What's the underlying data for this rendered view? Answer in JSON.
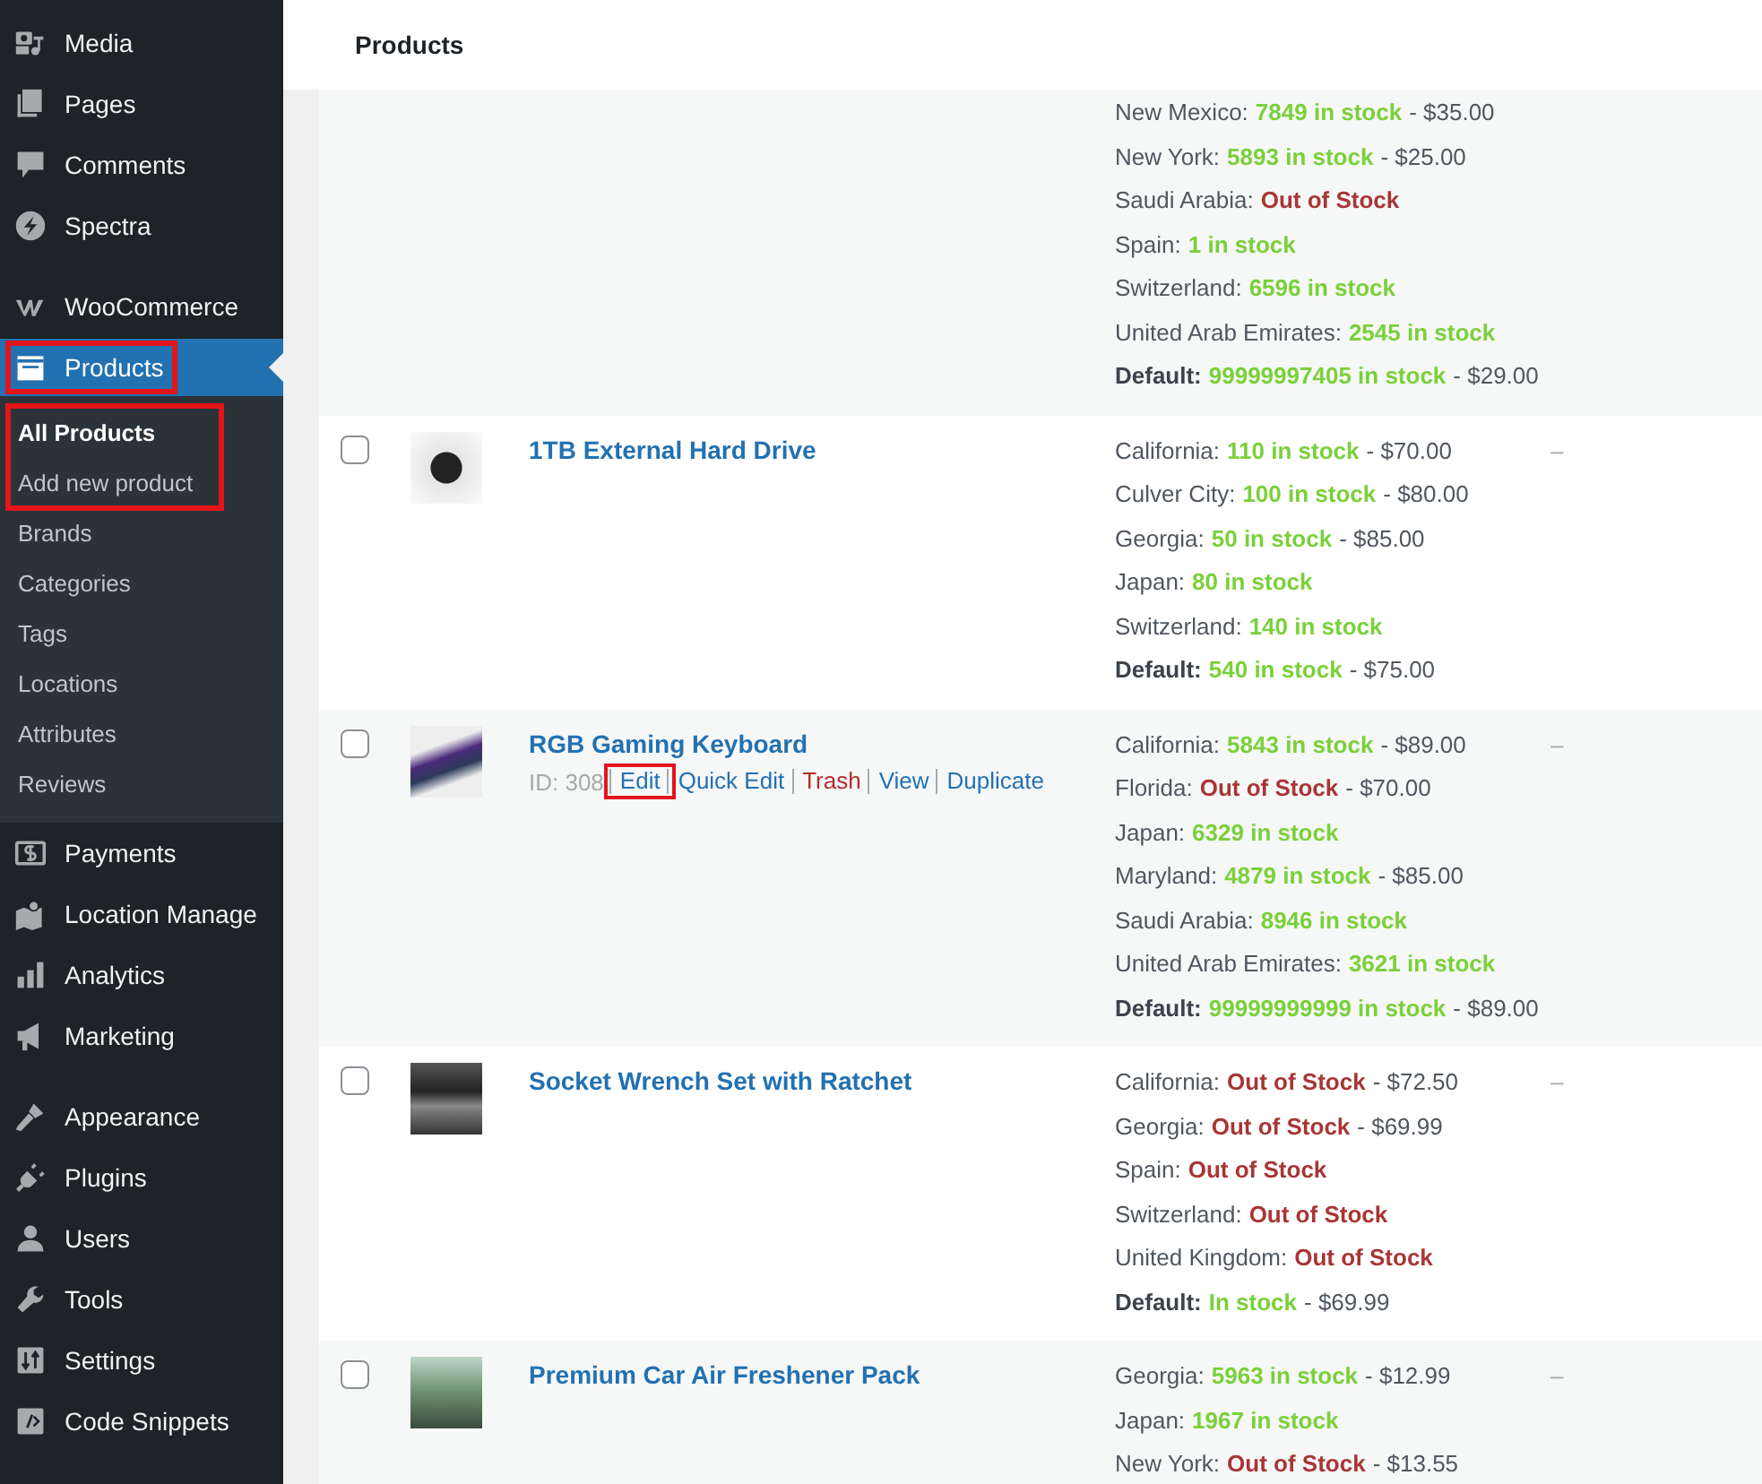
{
  "sidebar": {
    "groups": [
      {
        "items": [
          {
            "label": "Media",
            "current": false,
            "highlighted": false
          },
          {
            "label": "Pages",
            "current": false,
            "highlighted": false
          },
          {
            "label": "Comments",
            "current": false,
            "highlighted": false
          },
          {
            "label": "Spectra",
            "current": false,
            "highlighted": false
          }
        ]
      },
      {
        "items": [
          {
            "label": "WooCommerce",
            "current": false,
            "highlighted": false
          },
          {
            "label": "Products",
            "current": true,
            "highlighted": true,
            "submenu": [
              {
                "label": "All Products",
                "selected": true,
                "highlighted": true
              },
              {
                "label": "Add new product",
                "selected": false,
                "highlighted": true
              },
              {
                "label": "Brands",
                "selected": false,
                "highlighted": false
              },
              {
                "label": "Categories",
                "selected": false,
                "highlighted": false
              },
              {
                "label": "Tags",
                "selected": false,
                "highlighted": false
              },
              {
                "label": "Locations",
                "selected": false,
                "highlighted": false
              },
              {
                "label": "Attributes",
                "selected": false,
                "highlighted": false
              },
              {
                "label": "Reviews",
                "selected": false,
                "highlighted": false
              }
            ]
          },
          {
            "label": "Payments",
            "current": false,
            "highlighted": false
          },
          {
            "label": "Location Manage",
            "current": false,
            "highlighted": false
          },
          {
            "label": "Analytics",
            "current": false,
            "highlighted": false
          },
          {
            "label": "Marketing",
            "current": false,
            "highlighted": false
          }
        ]
      },
      {
        "items": [
          {
            "label": "Appearance",
            "current": false,
            "highlighted": false
          },
          {
            "label": "Plugins",
            "current": false,
            "highlighted": false
          },
          {
            "label": "Users",
            "current": false,
            "highlighted": false
          },
          {
            "label": "Tools",
            "current": false,
            "highlighted": false
          },
          {
            "label": "Settings",
            "current": false,
            "highlighted": false
          },
          {
            "label": "Code Snippets",
            "current": false,
            "highlighted": false
          }
        ]
      }
    ]
  },
  "header": {
    "title": "Products"
  },
  "table": {
    "rows": [
      {
        "stock": [
          {
            "location": "New Mexico:",
            "stock": "7849 in stock",
            "color": "#7ad03a",
            "price": "- $35.00",
            "default": false
          },
          {
            "location": "New York:",
            "stock": "5893 in stock",
            "color": "#7ad03a",
            "price": "- $25.00",
            "default": false
          },
          {
            "location": "Saudi Arabia:",
            "stock": "Out of Stock",
            "color": "#a83535",
            "default": false
          },
          {
            "location": "Spain:",
            "stock": "1 in stock",
            "color": "#7ad03a",
            "default": false
          },
          {
            "location": "Switzerland:",
            "stock": "6596 in stock",
            "color": "#7ad03a",
            "default": false
          },
          {
            "location": "United Arab Emirates:",
            "stock": "2545 in stock",
            "color": "#7ad03a",
            "default": false
          },
          {
            "location": "Default:",
            "stock": "99999997405 in stock",
            "color": "#7ad03a",
            "price": "- $29.00",
            "default": true
          }
        ]
      },
      {
        "checked": false,
        "name": "1TB External Hard Drive",
        "column_4": "–",
        "stock": [
          {
            "location": "California:",
            "stock": "110 in stock",
            "color": "#7ad03a",
            "price": "- $70.00",
            "default": false
          },
          {
            "location": "Culver City:",
            "stock": "100 in stock",
            "color": "#7ad03a",
            "price": "- $80.00",
            "default": false
          },
          {
            "location": "Georgia:",
            "stock": "50 in stock",
            "color": "#7ad03a",
            "price": "- $85.00",
            "default": false
          },
          {
            "location": "Japan:",
            "stock": "80 in stock",
            "color": "#7ad03a",
            "default": false
          },
          {
            "location": "Switzerland:",
            "stock": "140 in stock",
            "color": "#7ad03a",
            "default": false
          },
          {
            "location": "Default:",
            "stock": "540 in stock",
            "color": "#7ad03a",
            "price": "- $75.00",
            "default": true
          }
        ]
      },
      {
        "checked": false,
        "name": "RGB Gaming Keyboard",
        "column_4": "–",
        "id": "ID: 308",
        "actions": [
          {
            "label": "Edit",
            "kind": "link",
            "highlighted": true
          },
          {
            "label": "Quick Edit",
            "kind": "link",
            "highlighted": false
          },
          {
            "label": "Trash",
            "kind": "danger",
            "highlighted": false
          },
          {
            "label": "View",
            "kind": "link",
            "highlighted": false
          },
          {
            "label": "Duplicate",
            "kind": "link",
            "highlighted": false
          }
        ],
        "stock": [
          {
            "location": "California:",
            "stock": "5843 in stock",
            "color": "#7ad03a",
            "price": "- $89.00",
            "default": false
          },
          {
            "location": "Florida:",
            "stock": "Out of Stock",
            "color": "#a83535",
            "price": "- $70.00",
            "default": false
          },
          {
            "location": "Japan:",
            "stock": "6329 in stock",
            "color": "#7ad03a",
            "default": false
          },
          {
            "location": "Maryland:",
            "stock": "4879 in stock",
            "color": "#7ad03a",
            "price": "- $85.00",
            "default": false
          },
          {
            "location": "Saudi Arabia:",
            "stock": "8946 in stock",
            "color": "#7ad03a",
            "default": false
          },
          {
            "location": "United Arab Emirates:",
            "stock": "3621 in stock",
            "color": "#7ad03a",
            "default": false
          },
          {
            "location": "Default:",
            "stock": "99999999999 in stock",
            "color": "#7ad03a",
            "price": "- $89.00",
            "default": true
          }
        ]
      },
      {
        "checked": false,
        "name": "Socket Wrench Set with Ratchet",
        "column_4": "–",
        "stock": [
          {
            "location": "California:",
            "stock": "Out of Stock",
            "color": "#a83535",
            "price": "- $72.50",
            "default": false
          },
          {
            "location": "Georgia:",
            "stock": "Out of Stock",
            "color": "#a83535",
            "price": "- $69.99",
            "default": false
          },
          {
            "location": "Spain:",
            "stock": "Out of Stock",
            "color": "#a83535",
            "default": false
          },
          {
            "location": "Switzerland:",
            "stock": "Out of Stock",
            "color": "#a83535",
            "default": false
          },
          {
            "location": "United Kingdom:",
            "stock": "Out of Stock",
            "color": "#a83535",
            "default": false
          },
          {
            "location": "Default:",
            "stock": "In stock",
            "color": "#7ad03a",
            "price": "- $69.99",
            "default": true
          }
        ]
      },
      {
        "checked": false,
        "name": "Premium Car Air Freshener Pack",
        "column_4": "–",
        "stock": [
          {
            "location": "Georgia:",
            "stock": "5963 in stock",
            "color": "#7ad03a",
            "price": "- $12.99",
            "default": false
          },
          {
            "location": "Japan:",
            "stock": "1967 in stock",
            "color": "#7ad03a",
            "default": false
          },
          {
            "location": "New York:",
            "stock": "Out of Stock",
            "color": "#a83535",
            "price": "- $13.55",
            "default": false
          }
        ]
      }
    ]
  }
}
